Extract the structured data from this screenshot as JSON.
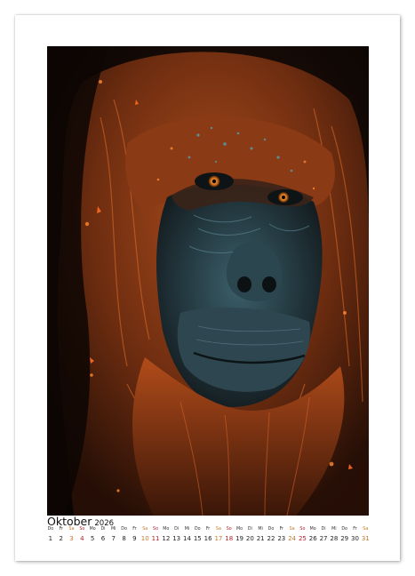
{
  "calendar": {
    "month": "Oktober",
    "year": "2026",
    "colors": {
      "saturday": "#c07a2a",
      "sunday": "#b01d2a",
      "weekday": "#222222"
    },
    "days": [
      {
        "dow": "Do",
        "num": "1",
        "type": "weekday"
      },
      {
        "dow": "Fr",
        "num": "2",
        "type": "weekday"
      },
      {
        "dow": "Sa",
        "num": "3",
        "type": "sat"
      },
      {
        "dow": "So",
        "num": "4",
        "type": "sun"
      },
      {
        "dow": "Mo",
        "num": "5",
        "type": "weekday"
      },
      {
        "dow": "Di",
        "num": "6",
        "type": "weekday"
      },
      {
        "dow": "Mi",
        "num": "7",
        "type": "weekday"
      },
      {
        "dow": "Do",
        "num": "8",
        "type": "weekday"
      },
      {
        "dow": "Fr",
        "num": "9",
        "type": "weekday"
      },
      {
        "dow": "Sa",
        "num": "10",
        "type": "sat"
      },
      {
        "dow": "So",
        "num": "11",
        "type": "sun"
      },
      {
        "dow": "Mo",
        "num": "12",
        "type": "weekday"
      },
      {
        "dow": "Di",
        "num": "13",
        "type": "weekday"
      },
      {
        "dow": "Mi",
        "num": "14",
        "type": "weekday"
      },
      {
        "dow": "Do",
        "num": "15",
        "type": "weekday"
      },
      {
        "dow": "Fr",
        "num": "16",
        "type": "weekday"
      },
      {
        "dow": "Sa",
        "num": "17",
        "type": "sat"
      },
      {
        "dow": "So",
        "num": "18",
        "type": "sun"
      },
      {
        "dow": "Mo",
        "num": "19",
        "type": "weekday"
      },
      {
        "dow": "Di",
        "num": "20",
        "type": "weekday"
      },
      {
        "dow": "Mi",
        "num": "21",
        "type": "weekday"
      },
      {
        "dow": "Do",
        "num": "22",
        "type": "weekday"
      },
      {
        "dow": "Fr",
        "num": "23",
        "type": "weekday"
      },
      {
        "dow": "Sa",
        "num": "24",
        "type": "sat"
      },
      {
        "dow": "So",
        "num": "25",
        "type": "sun"
      },
      {
        "dow": "Mo",
        "num": "26",
        "type": "weekday"
      },
      {
        "dow": "Di",
        "num": "27",
        "type": "weekday"
      },
      {
        "dow": "Mi",
        "num": "28",
        "type": "weekday"
      },
      {
        "dow": "Do",
        "num": "29",
        "type": "weekday"
      },
      {
        "dow": "Fr",
        "num": "30",
        "type": "weekday"
      },
      {
        "dow": "Sa",
        "num": "31",
        "type": "sat"
      }
    ]
  },
  "photo": {
    "subject": "orangutan-portrait",
    "colors": {
      "background": "#0c0806",
      "fur": "#a2461a",
      "fur_highlight": "#e0702a",
      "skin": "#2a4550",
      "eye": "#e08a1c"
    }
  }
}
